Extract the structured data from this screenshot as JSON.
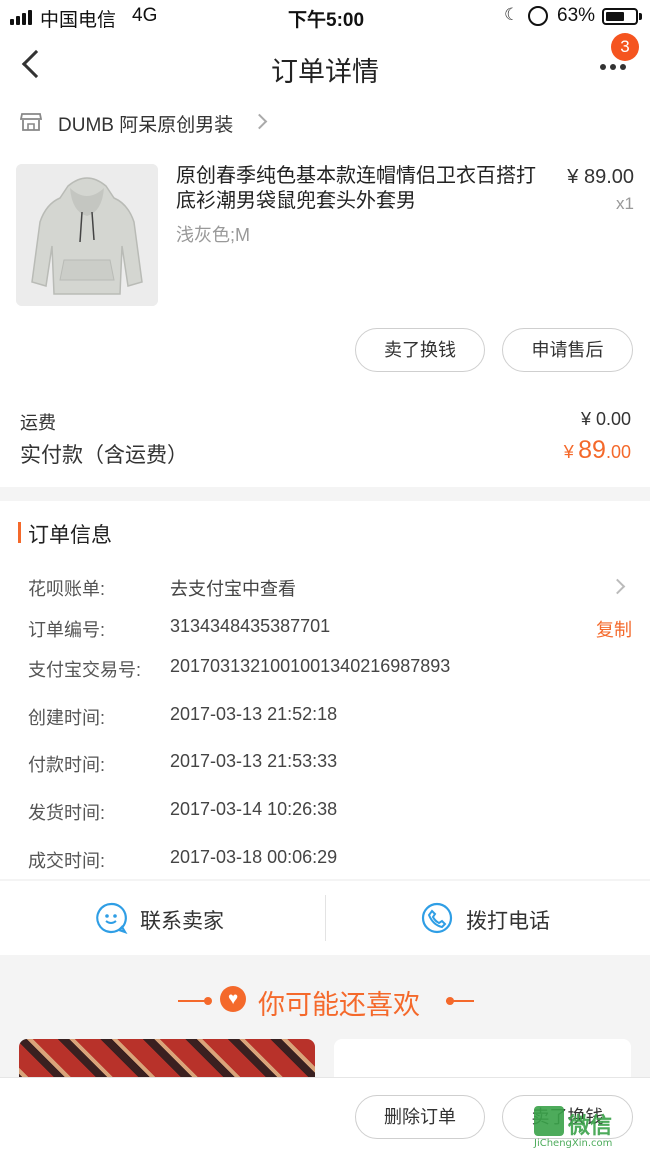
{
  "status_bar": {
    "carrier": "中国电信",
    "network": "4G",
    "time": "下午5:00",
    "battery_percent": "63%",
    "battery_level": 0.63
  },
  "nav": {
    "title": "订单详情",
    "badge_count": "3",
    "back_icon": "chevron-left-icon",
    "more_icon": "more-dots-icon"
  },
  "shop": {
    "name": "DUMB 阿呆原创男装"
  },
  "product": {
    "title": "原创春季纯色基本款连帽情侣卫衣百搭打底衫潮男袋鼠兜套头外套男",
    "sku": "浅灰色;M",
    "price": "¥ 89.00",
    "quantity": "x1",
    "actions": {
      "sell": "卖了换钱",
      "after_sale": "申请售后"
    }
  },
  "totals": {
    "shipping_label": "运费",
    "shipping_value": "¥ 0.00",
    "paid_label": "实付款（含运费）",
    "paid_currency": "¥",
    "paid_integer": "89",
    "paid_decimal": ".00"
  },
  "order_info": {
    "section_title": "订单信息",
    "rows": [
      {
        "label": "花呗账单:",
        "value": "去支付宝中查看"
      },
      {
        "label": "订单编号:",
        "value": "3134348435387701",
        "action": "复制"
      },
      {
        "label": "支付宝交易号:",
        "value": "2017031321001001340216987893"
      },
      {
        "label": "创建时间:",
        "value": "2017-03-13 21:52:18"
      },
      {
        "label": "付款时间:",
        "value": "2017-03-13 21:53:33"
      },
      {
        "label": "发货时间:",
        "value": "2017-03-14 10:26:38"
      },
      {
        "label": "成交时间:",
        "value": "2017-03-18 00:06:29"
      }
    ]
  },
  "contact": {
    "seller": "联系卖家",
    "phone": "拨打电话"
  },
  "recommend": {
    "title": "你可能还喜欢"
  },
  "bottom": {
    "delete": "删除订单",
    "sell": "卖了换钱"
  },
  "watermark": {
    "text": "微信",
    "url": "JiChengXin.com"
  },
  "colors": {
    "accent": "#f4692b",
    "badge": "#f5541f",
    "link_blue": "#2f9ee5"
  }
}
